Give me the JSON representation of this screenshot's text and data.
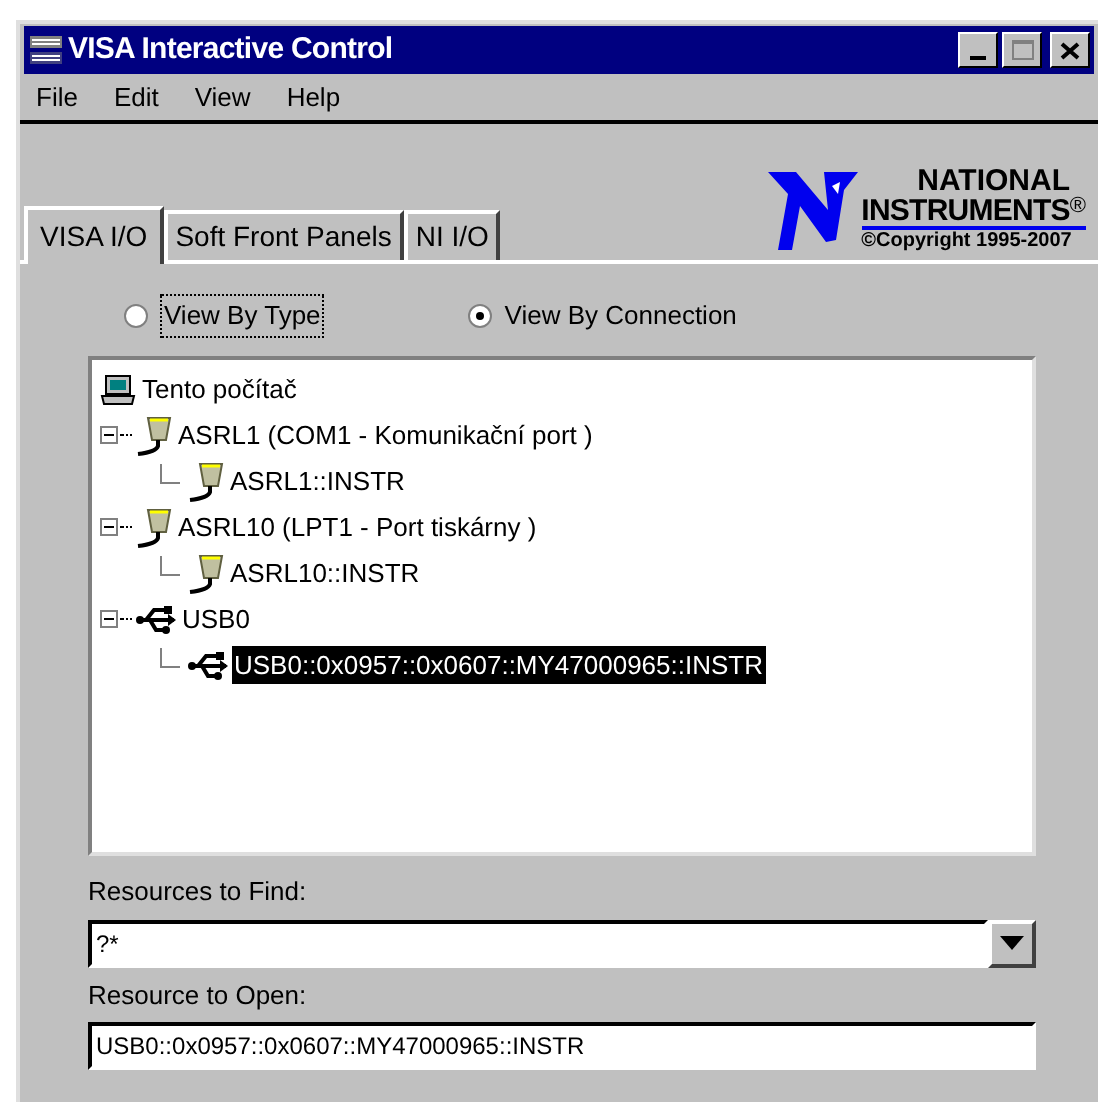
{
  "window": {
    "title": "VISA Interactive Control"
  },
  "menu": [
    "File",
    "Edit",
    "View",
    "Help"
  ],
  "tabs": [
    {
      "label": "VISA I/O",
      "selected": true
    },
    {
      "label": "Soft Front Panels",
      "selected": false
    },
    {
      "label": "NI I/O",
      "selected": false
    }
  ],
  "logo": {
    "line1": "NATIONAL",
    "line2": "INSTRUMENTS",
    "mark": "®",
    "copyright": "©Copyright 1995-2007"
  },
  "view_options": [
    {
      "label": "View By Type",
      "selected": false
    },
    {
      "label": "View By Connection",
      "selected": true
    }
  ],
  "tree": [
    {
      "label": "Tento počítač",
      "kind": "computer",
      "selected": false,
      "children": [
        {
          "label": "ASRL1  (COM1 - Komunikační port )",
          "kind": "serial",
          "expanded": true,
          "selected": false,
          "children": [
            {
              "label": "ASRL1::INSTR",
              "kind": "serial",
              "selected": false
            }
          ]
        },
        {
          "label": "ASRL10  (LPT1 - Port tiskárny )",
          "kind": "serial",
          "expanded": true,
          "selected": false,
          "children": [
            {
              "label": "ASRL10::INSTR",
              "kind": "serial",
              "selected": false
            }
          ]
        },
        {
          "label": "USB0",
          "kind": "usb",
          "expanded": true,
          "selected": false,
          "children": [
            {
              "label": "USB0::0x0957::0x0607::MY47000965::INSTR",
              "kind": "usb",
              "selected": true
            }
          ]
        }
      ]
    }
  ],
  "resources_to_find": {
    "label": "Resources to Find:",
    "value": "?*"
  },
  "resource_to_open": {
    "label": "Resource to Open:",
    "value": "USB0::0x0957::0x0607::MY47000965::INSTR"
  }
}
